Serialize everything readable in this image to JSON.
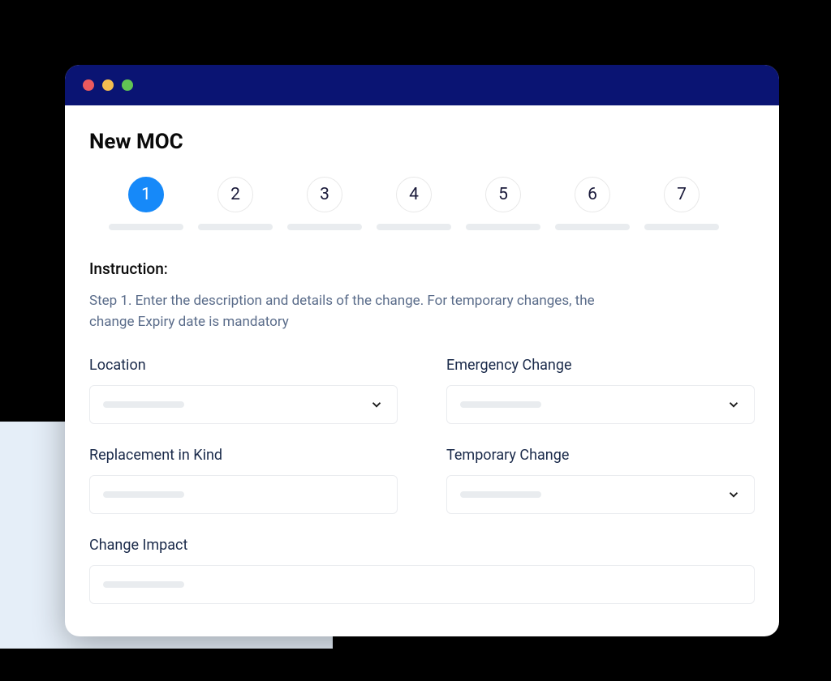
{
  "window": {
    "title": "New MOC"
  },
  "stepper": {
    "active": 1,
    "steps": [
      "1",
      "2",
      "3",
      "4",
      "5",
      "6",
      "7"
    ]
  },
  "instruction": {
    "heading": "Instruction:",
    "text": "Step 1. Enter the description and details of the change. For temporary changes, the change Expiry date is mandatory"
  },
  "form": {
    "location": {
      "label": "Location",
      "type": "select",
      "value": ""
    },
    "emergency_change": {
      "label": "Emergency Change",
      "type": "select",
      "value": ""
    },
    "replacement_in_kind": {
      "label": "Replacement in Kind",
      "type": "input",
      "value": ""
    },
    "temporary_change": {
      "label": "Temporary Change",
      "type": "select",
      "value": ""
    },
    "change_impact": {
      "label": "Change Impact",
      "type": "input",
      "value": ""
    }
  },
  "colors": {
    "titlebar": "#0a1473",
    "accent": "#1689f9",
    "bg_shape": "#e5eef8"
  }
}
